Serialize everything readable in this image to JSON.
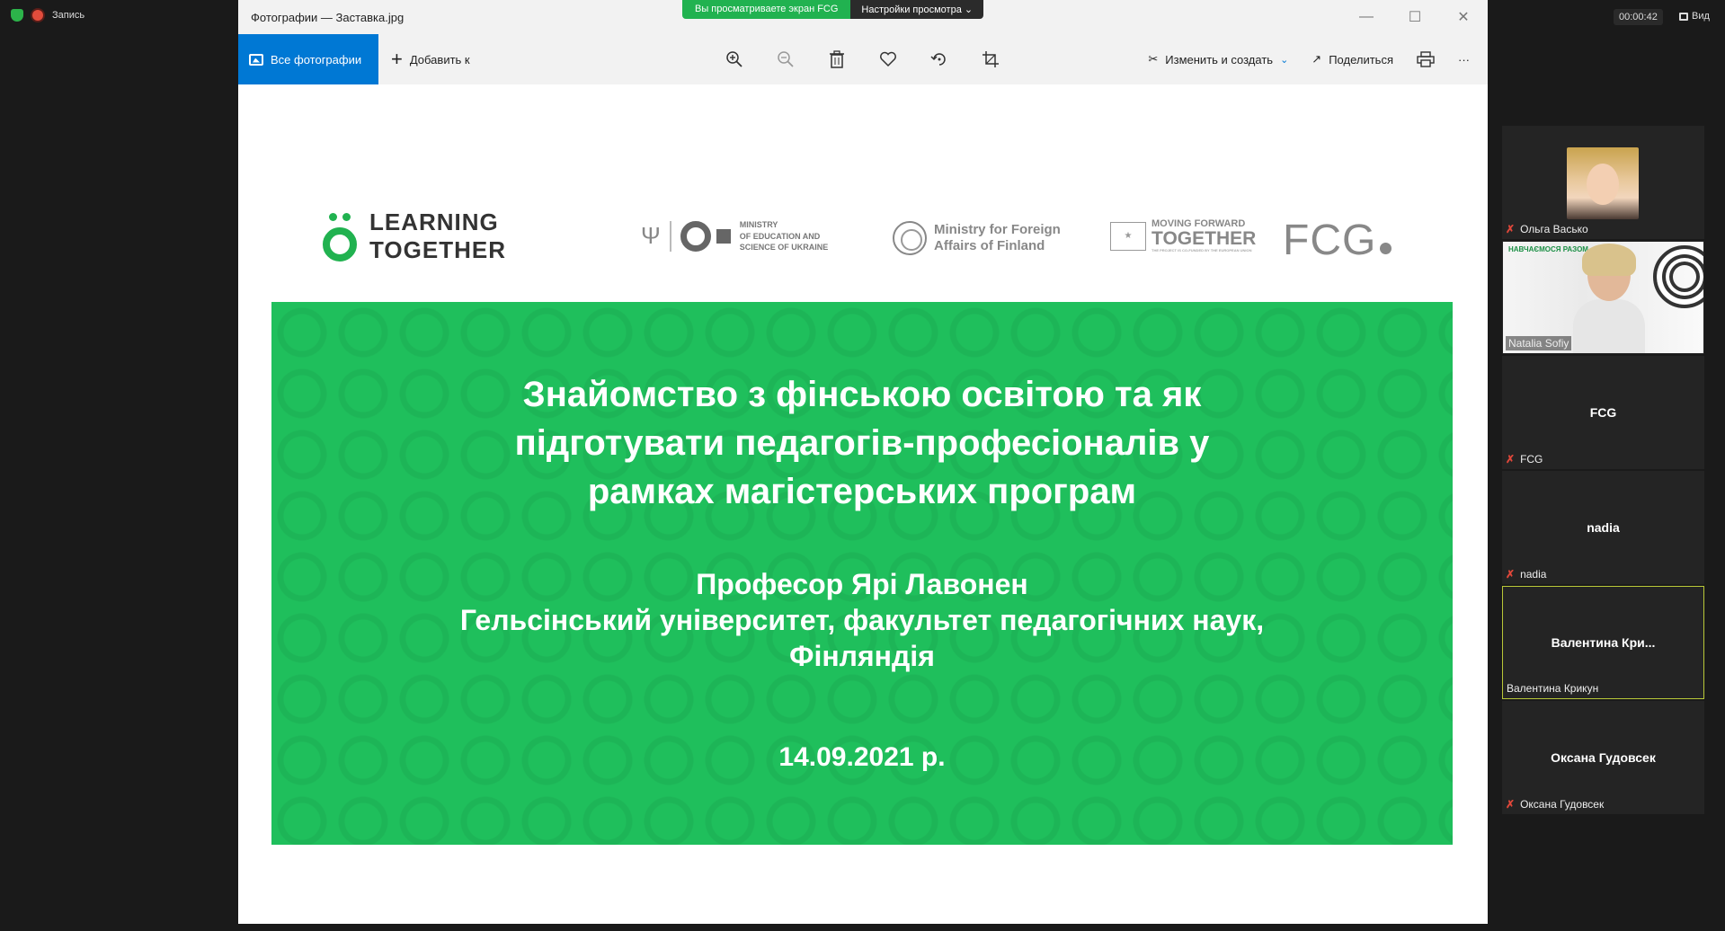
{
  "zoom": {
    "recording_label": "Запись",
    "share_banner": "Вы просматриваете экран FCG",
    "view_options": "Настройки просмотра ⌄",
    "timer": "00:00:42",
    "view_label": "Вид"
  },
  "photos": {
    "window_title": "Фотографии — Заставка.jpg",
    "all_photos": "Все фотографии",
    "add_to": "Добавить к",
    "edit_create": "Изменить и создать",
    "share": "Поделиться",
    "toolbar_icons": [
      "zoom-in-icon",
      "zoom-out-icon",
      "delete-icon",
      "heart-icon",
      "rotate-icon",
      "crop-icon"
    ],
    "window_controls": [
      "minimize",
      "maximize",
      "close"
    ]
  },
  "slide": {
    "logo_learning_line1": "LEARNING",
    "logo_learning_line2": "TOGETHER",
    "mon_line1": "MINISTRY",
    "mon_line2": "OF EDUCATION AND",
    "mon_line3": "SCIENCE OF UKRAINE",
    "mff_line1": "Ministry for Foreign",
    "mff_line2": "Affairs of Finland",
    "mft_small": "MOVING FORWARD",
    "mft_big": "TOGETHER",
    "mft_tiny": "THE PROJECT IS CO-FUNDED BY THE EUROPEAN UNION",
    "fcg": "FCG",
    "title": "Знайомство з фінською освітою та як\nпідготувати педагогів-професіоналів у\nрамках магістерських програм",
    "presenter": "Професор Ярі Лавонен\nГельсінський університет, факультет педагогічних наук,\nФінляндія",
    "date": "14.09.2021 р.",
    "bg_color": "#1fbf5c"
  },
  "participants": [
    {
      "name": "Ольга Васько",
      "muted": true,
      "type": "avatar"
    },
    {
      "name": "Natalia Sofiy",
      "muted": false,
      "type": "video",
      "overlay_text": "НАВЧАЄМОСЯ РАЗОМ"
    },
    {
      "name": "FCG",
      "display": "FCG",
      "muted": true,
      "type": "name"
    },
    {
      "name": "nadia",
      "display": "nadia",
      "muted": true,
      "type": "name"
    },
    {
      "name": "Валентина Крикун",
      "display": "Валентина Кри...",
      "muted": false,
      "type": "name",
      "active": true
    },
    {
      "name": "Оксана Гудовсек",
      "display": "Оксана Гудовсек",
      "muted": true,
      "type": "name"
    }
  ]
}
